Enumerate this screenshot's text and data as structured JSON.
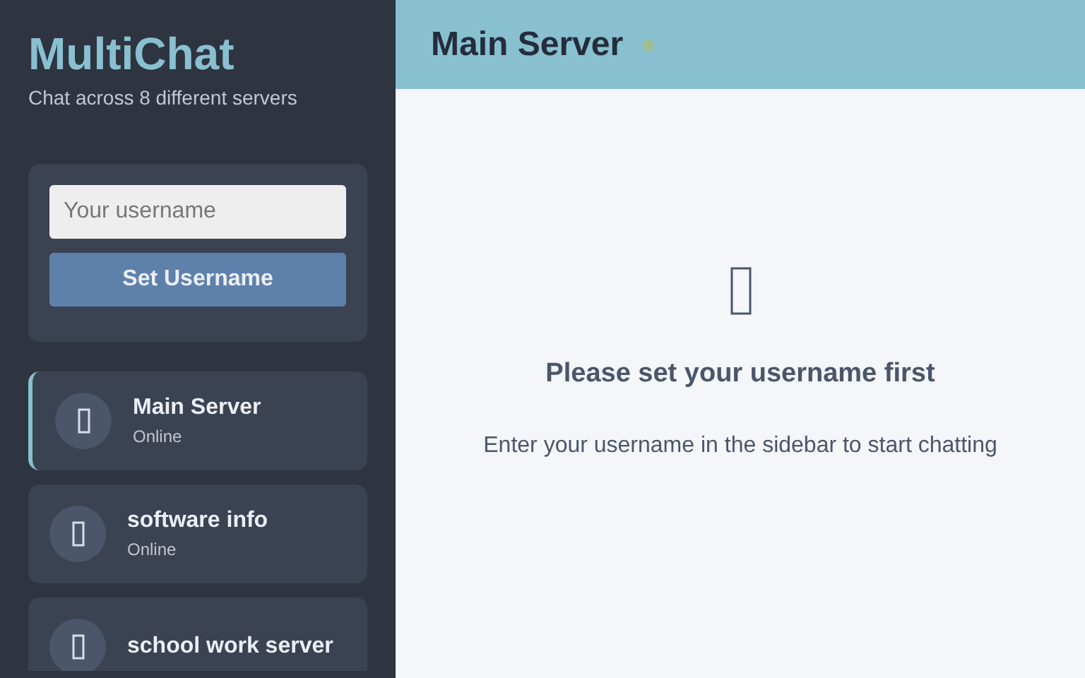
{
  "app": {
    "title": "MultiChat",
    "subtitle": "Chat across 8 different servers"
  },
  "username_form": {
    "placeholder": "Your username",
    "button": "Set Username"
  },
  "servers": [
    {
      "name": "Main Server",
      "status": "Online",
      "selected": true
    },
    {
      "name": "software info",
      "status": "Online",
      "selected": false
    },
    {
      "name": "school work server",
      "selected": false
    }
  ],
  "header": {
    "title": "Main Server",
    "online": true
  },
  "empty_state": {
    "heading": "Please set your username first",
    "message": "Enter your username in the sidebar to start chatting"
  }
}
